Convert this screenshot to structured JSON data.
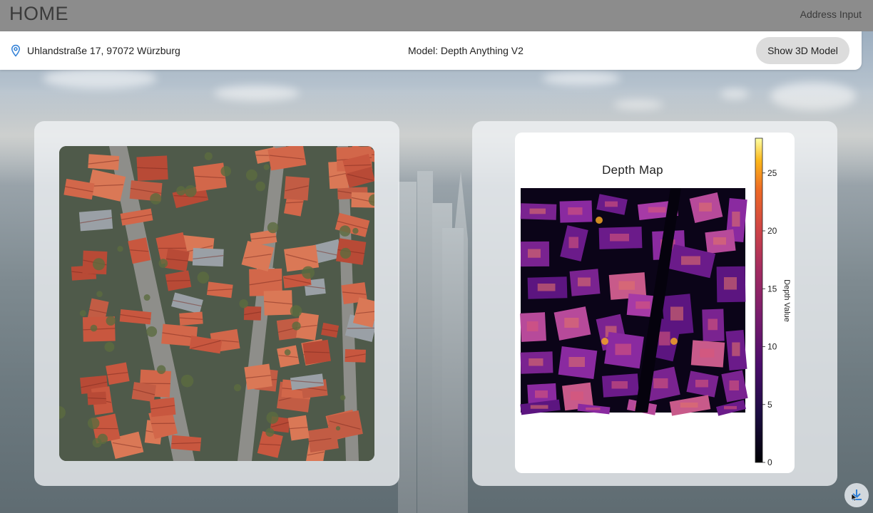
{
  "header": {
    "title": "HOME",
    "address_link": "Address Input"
  },
  "infobar": {
    "location_icon": "map-pin-icon",
    "address": "Uhlandstraße 17, 97072 Würzburg",
    "model": "Model: Depth Anything V2",
    "show_3d_label": "Show 3D Model"
  },
  "panels": {
    "satellite_image": "aerial-rooftops",
    "depth_map_image": "depth-heatmap"
  },
  "chart_data": {
    "type": "heatmap",
    "title": "Depth Map",
    "colorbar_label": "Depth Value",
    "colorbar_ticks": [
      0,
      5,
      10,
      15,
      20,
      25
    ],
    "range": [
      0,
      28
    ],
    "colormap": "inferno"
  },
  "corner_button": {
    "icon": "download-cursor-icon"
  },
  "colors": {
    "topbar": "#8c8c8c",
    "button_bg": "#dcdcdc",
    "pin": "#2f7fd6"
  }
}
